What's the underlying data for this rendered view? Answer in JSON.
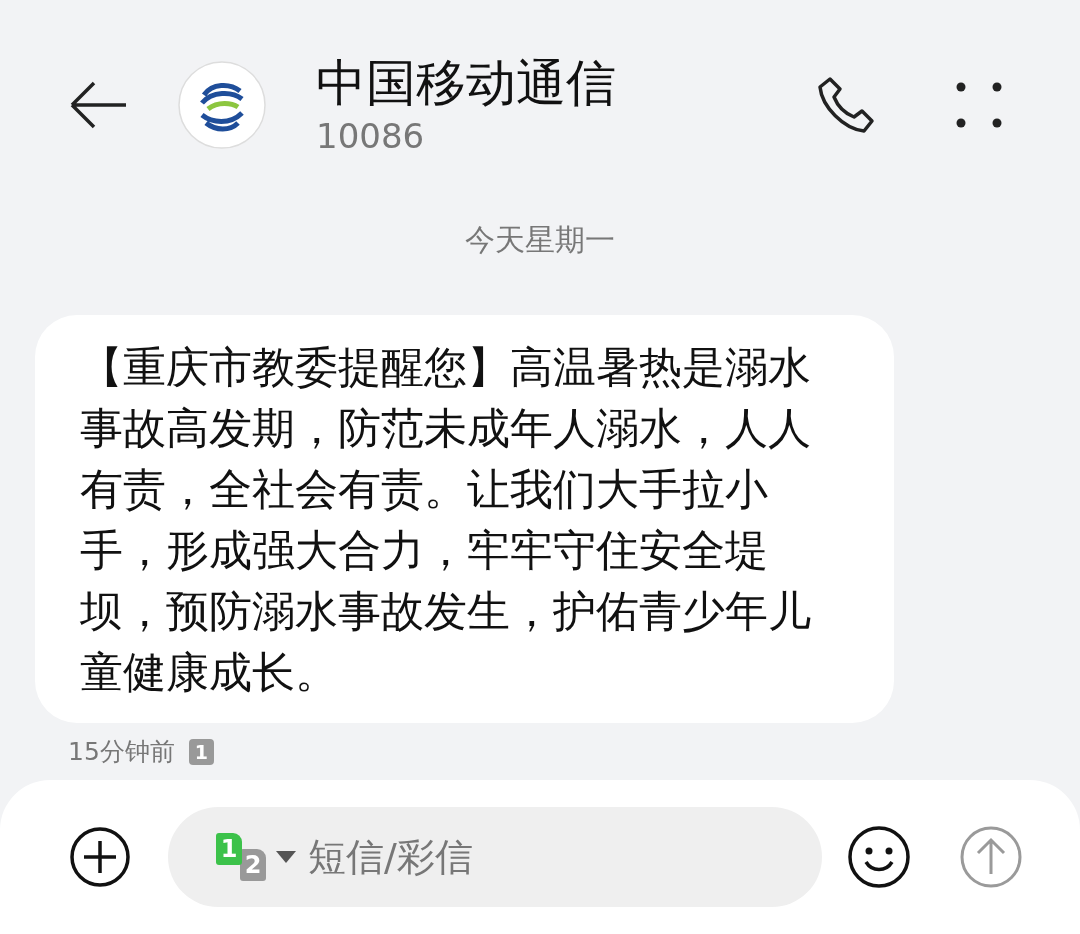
{
  "header": {
    "title": "中国移动通信",
    "number": "10086"
  },
  "thread": {
    "date": "今天星期一",
    "messages": [
      {
        "text": "【重庆市教委提醒您】高温暑热是溺水事故高发期，防范未成年人溺水，人人有责，全社会有责。让我们大手拉小手，形成强大合力，牢牢守住安全堤坝，预防溺水事故发生，护佑青少年儿童健康成长。",
        "time": "15分钟前",
        "sim": "1"
      }
    ]
  },
  "composer": {
    "sim_badges": [
      {
        "label": "1",
        "selected": true
      },
      {
        "label": "2",
        "selected": false
      }
    ],
    "placeholder": "短信/彩信"
  }
}
